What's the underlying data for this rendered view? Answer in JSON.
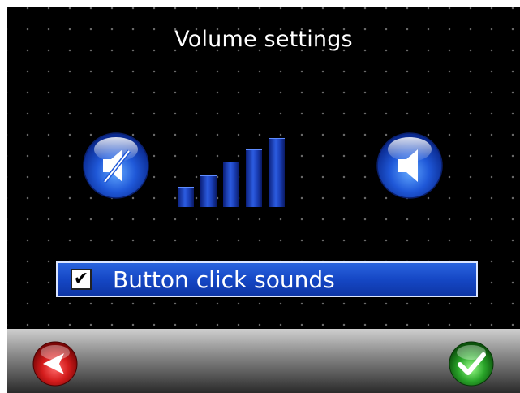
{
  "screen": {
    "title": "Volume settings"
  },
  "volume": {
    "level": 5,
    "max_level": 5,
    "mute_icon": "speaker-mute-icon",
    "loud_icon": "speaker-icon"
  },
  "click_sounds": {
    "label": "Button click sounds",
    "checked": true,
    "check_glyph": "✔"
  },
  "footer": {
    "back_icon": "back-arrow-icon",
    "confirm_icon": "checkmark-icon"
  },
  "colors": {
    "background": "#000000",
    "accent_blue": "#1547c5",
    "back_red": "#d41c1c",
    "confirm_green": "#2aa52a"
  }
}
